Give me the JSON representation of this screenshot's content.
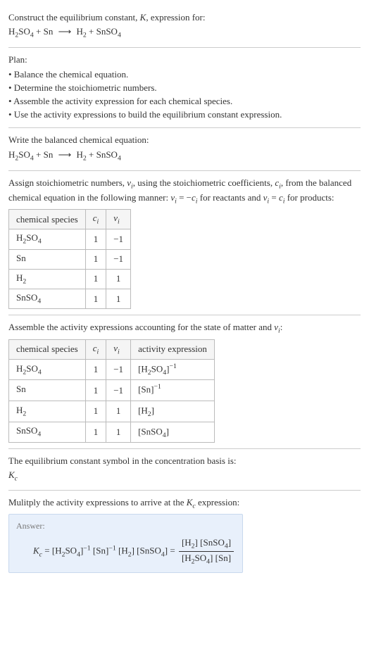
{
  "s1": {
    "line1a": "Construct the equilibrium constant, ",
    "K": "K",
    "line1b": ", expression for:",
    "r1": "H",
    "r1sub": "2",
    "r1b": "SO",
    "r1bsub": "4",
    "plus1": "+",
    "r2": "Sn",
    "arrow": "⟶",
    "p1": "H",
    "p1sub": "2",
    "plus2": "+",
    "p2": "SnSO",
    "p2sub": "4"
  },
  "s2": {
    "heading": "Plan:",
    "b1": "• Balance the chemical equation.",
    "b2": "• Determine the stoichiometric numbers.",
    "b3": "• Assemble the activity expression for each chemical species.",
    "b4": "• Use the activity expressions to build the equilibrium constant expression."
  },
  "s3": {
    "heading": "Write the balanced chemical equation:",
    "r1": "H",
    "r1sub": "2",
    "r1b": "SO",
    "r1bsub": "4",
    "plus1": "+",
    "r2": "Sn",
    "arrow": "⟶",
    "p1": "H",
    "p1sub": "2",
    "plus2": "+",
    "p2": "SnSO",
    "p2sub": "4"
  },
  "s4": {
    "line1a": "Assign stoichiometric numbers, ",
    "nu": "ν",
    "nusub": "i",
    "line1b": ", using the stoichiometric coefficients, ",
    "c": "c",
    "csub": "i",
    "line1c": ", from the balanced chemical equation in the following manner: ",
    "rel1a": "ν",
    "rel1asub": "i",
    "rel1eq": " = −",
    "rel1b": "c",
    "rel1bsub": "i",
    "line1d": " for reactants and ",
    "rel2a": "ν",
    "rel2asub": "i",
    "rel2eq": " = ",
    "rel2b": "c",
    "rel2bsub": "i",
    "line1e": " for products:",
    "h1": "chemical species",
    "h2": "c",
    "h2sub": "i",
    "h3": "ν",
    "h3sub": "i",
    "rows": [
      {
        "sp_a": "H",
        "sp_asub": "2",
        "sp_b": "SO",
        "sp_bsub": "4",
        "ci": "1",
        "nui": "−1"
      },
      {
        "sp_a": "Sn",
        "sp_asub": "",
        "sp_b": "",
        "sp_bsub": "",
        "ci": "1",
        "nui": "−1"
      },
      {
        "sp_a": "H",
        "sp_asub": "2",
        "sp_b": "",
        "sp_bsub": "",
        "ci": "1",
        "nui": "1"
      },
      {
        "sp_a": "SnSO",
        "sp_asub": "4",
        "sp_b": "",
        "sp_bsub": "",
        "ci": "1",
        "nui": "1"
      }
    ]
  },
  "s5": {
    "heading_a": "Assemble the activity expressions accounting for the state of matter and ",
    "nu": "ν",
    "nusub": "i",
    "heading_b": ":",
    "h1": "chemical species",
    "h2": "c",
    "h2sub": "i",
    "h3": "ν",
    "h3sub": "i",
    "h4": "activity expression",
    "rows": [
      {
        "sp_a": "H",
        "sp_asub": "2",
        "sp_b": "SO",
        "sp_bsub": "4",
        "ci": "1",
        "nui": "−1",
        "ae_pre": "[",
        "ae_a": "H",
        "ae_asub": "2",
        "ae_b": "SO",
        "ae_bsub": "4",
        "ae_post": "]",
        "ae_sup": "−1"
      },
      {
        "sp_a": "Sn",
        "sp_asub": "",
        "sp_b": "",
        "sp_bsub": "",
        "ci": "1",
        "nui": "−1",
        "ae_pre": "[",
        "ae_a": "Sn",
        "ae_asub": "",
        "ae_b": "",
        "ae_bsub": "",
        "ae_post": "]",
        "ae_sup": "−1"
      },
      {
        "sp_a": "H",
        "sp_asub": "2",
        "sp_b": "",
        "sp_bsub": "",
        "ci": "1",
        "nui": "1",
        "ae_pre": "[",
        "ae_a": "H",
        "ae_asub": "2",
        "ae_b": "",
        "ae_bsub": "",
        "ae_post": "]",
        "ae_sup": ""
      },
      {
        "sp_a": "SnSO",
        "sp_asub": "4",
        "sp_b": "",
        "sp_bsub": "",
        "ci": "1",
        "nui": "1",
        "ae_pre": "[",
        "ae_a": "SnSO",
        "ae_asub": "4",
        "ae_b": "",
        "ae_bsub": "",
        "ae_post": "]",
        "ae_sup": ""
      }
    ]
  },
  "s6": {
    "heading": "The equilibrium constant symbol in the concentration basis is:",
    "symbol": "K",
    "symbolsub": "c"
  },
  "s7": {
    "heading_a": "Mulitply the activity expressions to arrive at the ",
    "K": "K",
    "Ksub": "c",
    "heading_b": " expression:",
    "answer_label": "Answer:",
    "lhs_K": "K",
    "lhs_Ksub": "c",
    "eq": " = ",
    "t1_pre": "[",
    "t1a": "H",
    "t1asub": "2",
    "t1b": "SO",
    "t1bsub": "4",
    "t1_post": "]",
    "t1_sup": "−1",
    "t2_pre": " [",
    "t2a": "Sn",
    "t2_post": "]",
    "t2_sup": "−1",
    "t3_pre": " [",
    "t3a": "H",
    "t3asub": "2",
    "t3_post": "]",
    "t4_pre": " [",
    "t4a": "SnSO",
    "t4asub": "4",
    "t4_post": "]",
    "eq2": " = ",
    "num_t1_pre": "[",
    "num_t1a": "H",
    "num_t1asub": "2",
    "num_t1_post": "]",
    "num_t2_pre": " [",
    "num_t2a": "SnSO",
    "num_t2asub": "4",
    "num_t2_post": "]",
    "den_t1_pre": "[",
    "den_t1a": "H",
    "den_t1asub": "2",
    "den_t1b": "SO",
    "den_t1bsub": "4",
    "den_t1_post": "]",
    "den_t2_pre": " [",
    "den_t2a": "Sn",
    "den_t2_post": "]"
  }
}
